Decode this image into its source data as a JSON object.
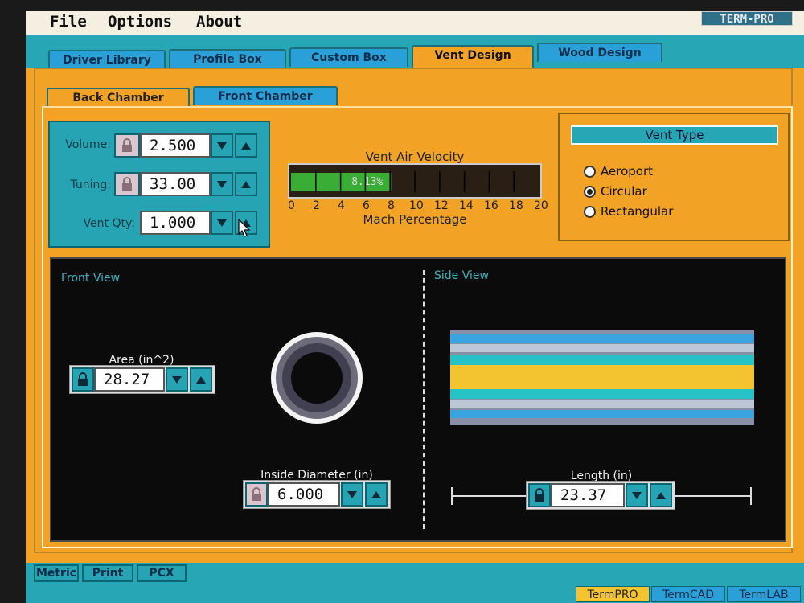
{
  "menu": {
    "file": "File",
    "options": "Options",
    "about": "About",
    "brand": "TERM-PRO"
  },
  "tabs": [
    {
      "label": "Driver Library"
    },
    {
      "label": "Profile Box"
    },
    {
      "label": "Custom Box"
    },
    {
      "label": "Vent Design",
      "active": true
    },
    {
      "label": "Wood Design"
    }
  ],
  "subtabs": [
    {
      "label": "Back Chamber",
      "active": true
    },
    {
      "label": "Front Chamber"
    }
  ],
  "controls": {
    "volume": {
      "label": "Volume:",
      "value": "2.500"
    },
    "tuning": {
      "label": "Tuning:",
      "value": "33.00"
    },
    "vent_qty": {
      "label": "Vent Qty:",
      "value": "1.000"
    }
  },
  "gauge": {
    "title": "Vent Air Velocity",
    "value_text": "8.13%",
    "percent": 8.13,
    "max": 20,
    "ticks": [
      "0",
      "2",
      "4",
      "6",
      "8",
      "10",
      "12",
      "14",
      "16",
      "18",
      "20"
    ],
    "axis_label": "Mach Percentage"
  },
  "vent_type": {
    "title": "Vent Type",
    "options": [
      "Aeroport",
      "Circular",
      "Rectangular"
    ],
    "selected": "Circular"
  },
  "front_view": {
    "title": "Front View",
    "area_label": "Area (in^2)",
    "area_value": "28.27",
    "diameter_label": "Inside Diameter (in)",
    "diameter_value": "6.000"
  },
  "side_view": {
    "title": "Side View",
    "length_label": "Length (in)",
    "length_value": "23.37"
  },
  "bottom": {
    "buttons": [
      "Metric",
      "Print",
      "PCX"
    ],
    "apps": [
      "TermPRO",
      "TermCAD",
      "TermLAB"
    ],
    "active_app": "TermPRO"
  },
  "colors": {
    "panel": "#f2a326",
    "teal": "#27a7b6",
    "blue_tab": "#2aa0d8",
    "gauge_green": "#3aad35"
  }
}
